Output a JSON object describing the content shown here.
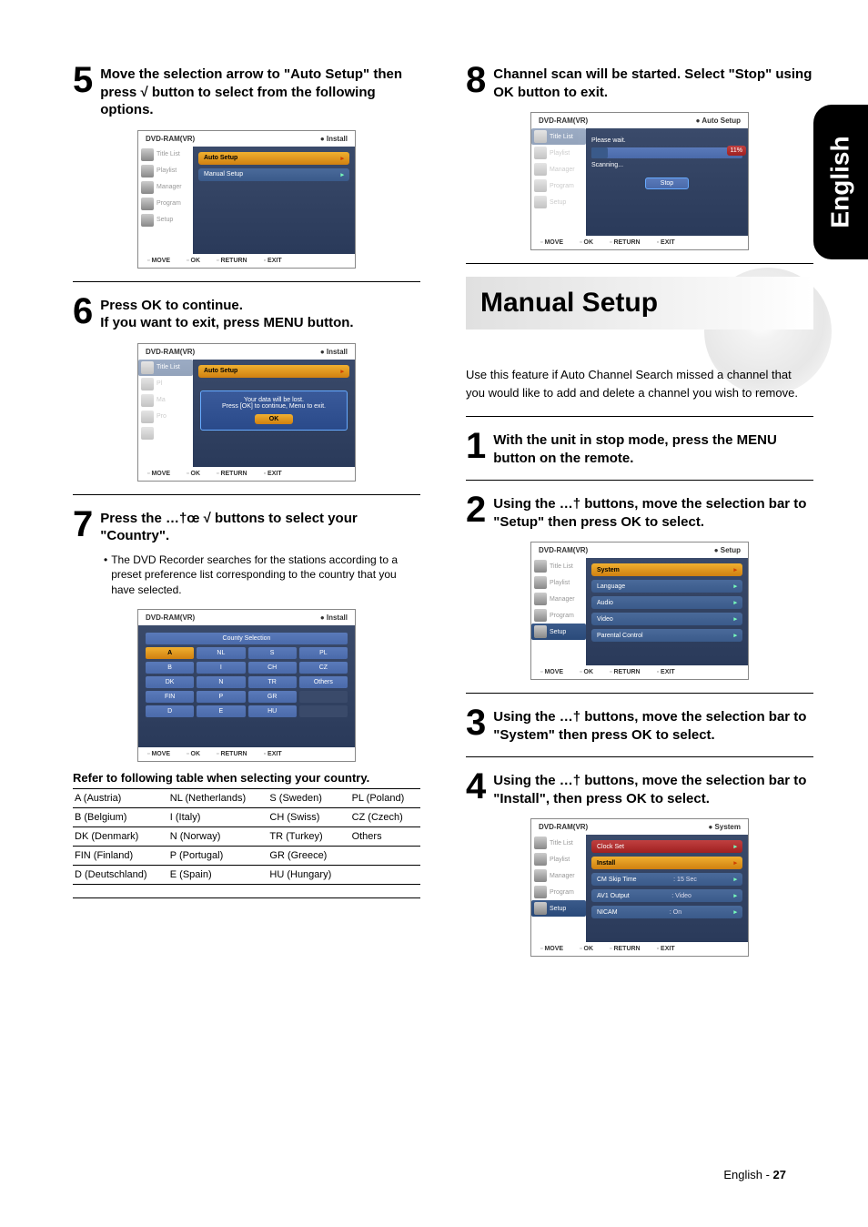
{
  "side_tab": "English",
  "footer": {
    "label": "English - ",
    "page": "27"
  },
  "osd_common": {
    "header_left": "DVD-RAM(VR)",
    "sidebar": [
      "Title List",
      "Playlist",
      "Manager",
      "Program",
      "Setup"
    ],
    "foot": [
      "MOVE",
      "OK",
      "RETURN",
      "EXIT"
    ]
  },
  "left": {
    "step5": {
      "num": "5",
      "text": "Move the selection arrow to \"Auto Setup\" then press √ button to select from the following options.",
      "osd": {
        "header_right": "Install",
        "items": [
          "Auto Setup",
          "Manual Setup"
        ]
      }
    },
    "step6": {
      "num": "6",
      "text_a": "Press OK to continue.",
      "text_b": "If you want to exit, press MENU button.",
      "osd": {
        "header_right": "Install",
        "row": "Auto Setup",
        "popup_line1": "Your data will be lost.",
        "popup_line2": "Press [OK] to continue, Menu to exit.",
        "ok": "OK"
      }
    },
    "step7": {
      "num": "7",
      "text": "Press the …†œ √ buttons to select your \"Country\".",
      "bullet": "The DVD Recorder searches for the stations according to a preset preference list corresponding to the country that you have selected.",
      "osd": {
        "header_right": "Install",
        "grid_head": "County Selection",
        "cells": [
          [
            "A",
            "NL",
            "S",
            "PL"
          ],
          [
            "B",
            "I",
            "CH",
            "CZ"
          ],
          [
            "DK",
            "N",
            "TR",
            "Others"
          ],
          [
            "FIN",
            "P",
            "GR",
            ""
          ],
          [
            "D",
            "E",
            "HU",
            ""
          ]
        ]
      },
      "ref": "Refer to following table when selecting your country.",
      "table": [
        [
          "A (Austria)",
          "NL (Netherlands)",
          "S (Sweden)",
          "PL (Poland)"
        ],
        [
          "B (Belgium)",
          "I (Italy)",
          "CH (Swiss)",
          "CZ (Czech)"
        ],
        [
          "DK (Denmark)",
          "N (Norway)",
          "TR (Turkey)",
          "Others"
        ],
        [
          "FIN (Finland)",
          "P (Portugal)",
          "GR (Greece)",
          ""
        ],
        [
          "D (Deutschland)",
          "E (Spain)",
          "HU (Hungary)",
          ""
        ]
      ]
    }
  },
  "right": {
    "step8": {
      "num": "8",
      "text": "Channel scan will be started. Select \"Stop\" using OK button to exit.",
      "osd": {
        "header_right": "Auto Setup",
        "wait": "Please wait.",
        "percent": "11%",
        "scanning": "Scanning...",
        "stop": "Stop"
      }
    },
    "section_head": "Manual Setup",
    "section_body": "Use this feature if Auto Channel Search missed a channel that you would like to add and delete a channel you wish to remove.",
    "step1": {
      "num": "1",
      "text": "With the unit in stop mode, press the MENU button on the remote."
    },
    "step2": {
      "num": "2",
      "text": "Using the …† buttons, move the selection bar to \"Setup\" then press OK to select.",
      "osd": {
        "header_right": "Setup",
        "items": [
          "System",
          "Language",
          "Audio",
          "Video",
          "Parental Control"
        ]
      }
    },
    "step3": {
      "num": "3",
      "text": "Using the …† buttons, move the selection bar to \"System\" then press OK to select."
    },
    "step4": {
      "num": "4",
      "text": "Using the …† buttons, move the selection bar to \"Install\", then press OK to select.",
      "osd": {
        "header_right": "System",
        "rows": [
          {
            "label": "Clock Set",
            "val": ""
          },
          {
            "label": "Install",
            "val": ""
          },
          {
            "label": "CM Skip Time",
            "val": ": 15 Sec"
          },
          {
            "label": "AV1 Output",
            "val": ": Video"
          },
          {
            "label": "NICAM",
            "val": ": On"
          }
        ]
      }
    }
  }
}
